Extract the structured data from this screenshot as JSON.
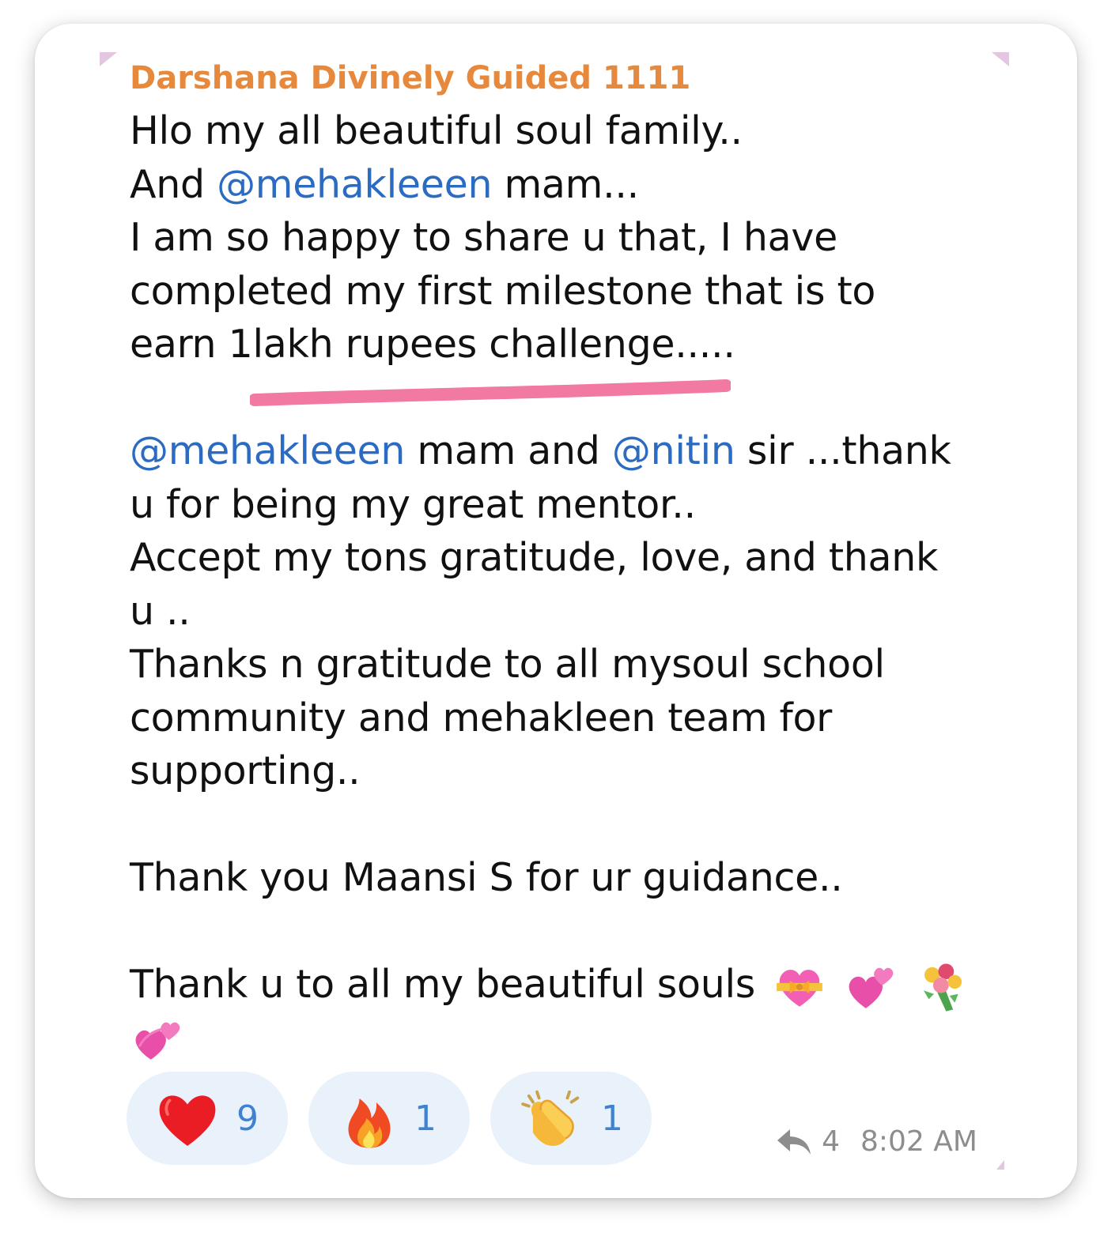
{
  "message": {
    "sender": "Darshana Divinely Guided 1111",
    "lines": {
      "l1": "Hlo my all beautiful soul family..",
      "l2_pre": "And ",
      "l2_mention": "@mehakleeen",
      "l2_post": " mam...",
      "l3": "I am so happy to share u that, I have",
      "l4": "completed my first milestone that is to",
      "l5": "earn  1lakh rupees challenge.....",
      "l7_mention1": "@mehakleeen",
      "l7_mid": " mam and ",
      "l7_mention2": "@nitin",
      "l7_post": " sir ...thank",
      "l8": "u for being my great mentor..",
      "l9": "Accept my tons  gratitude, love, and thank",
      "l10": "u ..",
      "l11": "Thanks n gratitude to all mysoul school",
      "l12": "community and mehakleen team for",
      "l13": "supporting..",
      "l15": "Thank you Maansi S for ur guidance..",
      "l17": "Thank u to all my beautiful souls"
    },
    "emojis": [
      "heart-with-ribbon",
      "two-hearts",
      "bouquet",
      "revolving-hearts"
    ],
    "colors": {
      "sender": "#e7893c",
      "mention": "#2c6bc2",
      "highlight": "#f06a98",
      "reaction_bg": "#e9f1fb",
      "reaction_count": "#3f82d2"
    }
  },
  "reactions": [
    {
      "icon": "heart-icon",
      "count": "9"
    },
    {
      "icon": "fire-icon",
      "count": "1"
    },
    {
      "icon": "clapping-hands-icon",
      "count": "1"
    }
  ],
  "meta": {
    "reply_count": "4",
    "time": "8:02 AM"
  }
}
